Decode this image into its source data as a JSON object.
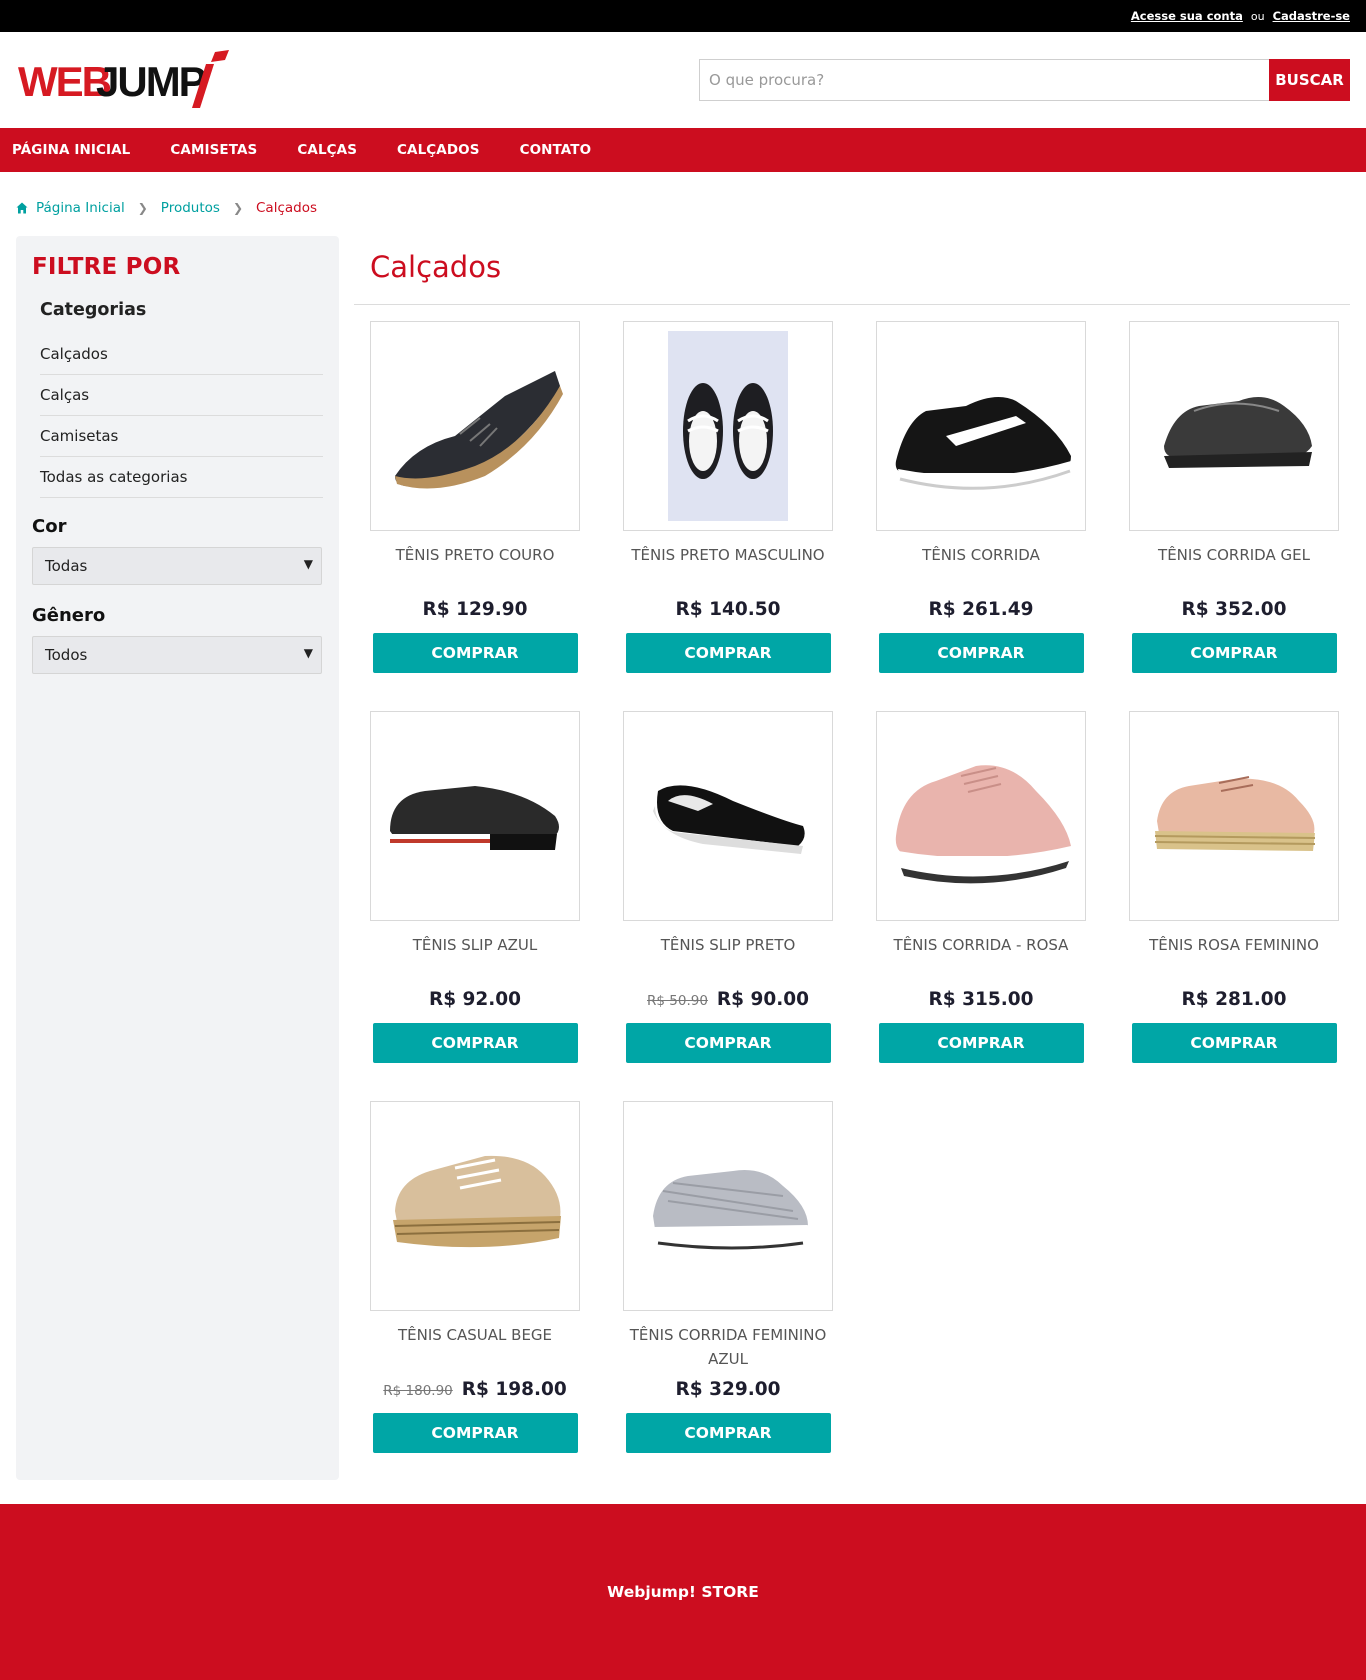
{
  "topbar": {
    "login_label": "Acesse sua conta",
    "separator": "ou",
    "register_label": "Cadastre-se"
  },
  "header": {
    "logo_text_web": "WEB",
    "logo_text_jump": "JUMP",
    "search_placeholder": "O que procura?",
    "search_button": "BUSCAR"
  },
  "nav": {
    "items": [
      "PÁGINA INICIAL",
      "CAMISETAS",
      "CALÇAS",
      "CALÇADOS",
      "CONTATO"
    ]
  },
  "breadcrumb": {
    "items": [
      "Página Inicial",
      "Produtos",
      "Calçados"
    ],
    "icon": "home-icon"
  },
  "sidebar": {
    "title": "FILTRE POR",
    "categories_title": "Categorias",
    "categories": [
      "Calçados",
      "Calças",
      "Camisetas",
      "Todas as categorias"
    ],
    "color_title": "Cor",
    "color_value": "Todas",
    "gender_title": "Gênero",
    "gender_value": "Todos"
  },
  "main": {
    "title": "Calçados",
    "buy_label": "COMPRAR",
    "products": [
      {
        "name": "TÊNIS PRETO COURO",
        "price": "R$ 129.90",
        "old_price": ""
      },
      {
        "name": "TÊNIS PRETO MASCULINO",
        "price": "R$ 140.50",
        "old_price": ""
      },
      {
        "name": "TÊNIS CORRIDA",
        "price": "R$ 261.49",
        "old_price": ""
      },
      {
        "name": "TÊNIS CORRIDA GEL",
        "price": "R$ 352.00",
        "old_price": ""
      },
      {
        "name": "TÊNIS SLIP AZUL",
        "price": "R$ 92.00",
        "old_price": ""
      },
      {
        "name": "TÊNIS SLIP PRETO",
        "price": "R$ 90.00",
        "old_price": "R$ 50.90"
      },
      {
        "name": "TÊNIS CORRIDA - ROSA",
        "price": "R$ 315.00",
        "old_price": ""
      },
      {
        "name": "TÊNIS ROSA FEMININO",
        "price": "R$ 281.00",
        "old_price": ""
      },
      {
        "name": "TÊNIS CASUAL BEGE",
        "price": "R$ 198.00",
        "old_price": "R$ 180.90"
      },
      {
        "name": "TÊNIS CORRIDA FEMININO AZUL",
        "price": "R$ 329.00",
        "old_price": ""
      }
    ]
  },
  "footer": {
    "text": "Webjump! STORE"
  },
  "colors": {
    "brand_red": "#cc0d1f",
    "teal": "#00a6a6",
    "black": "#000000"
  }
}
